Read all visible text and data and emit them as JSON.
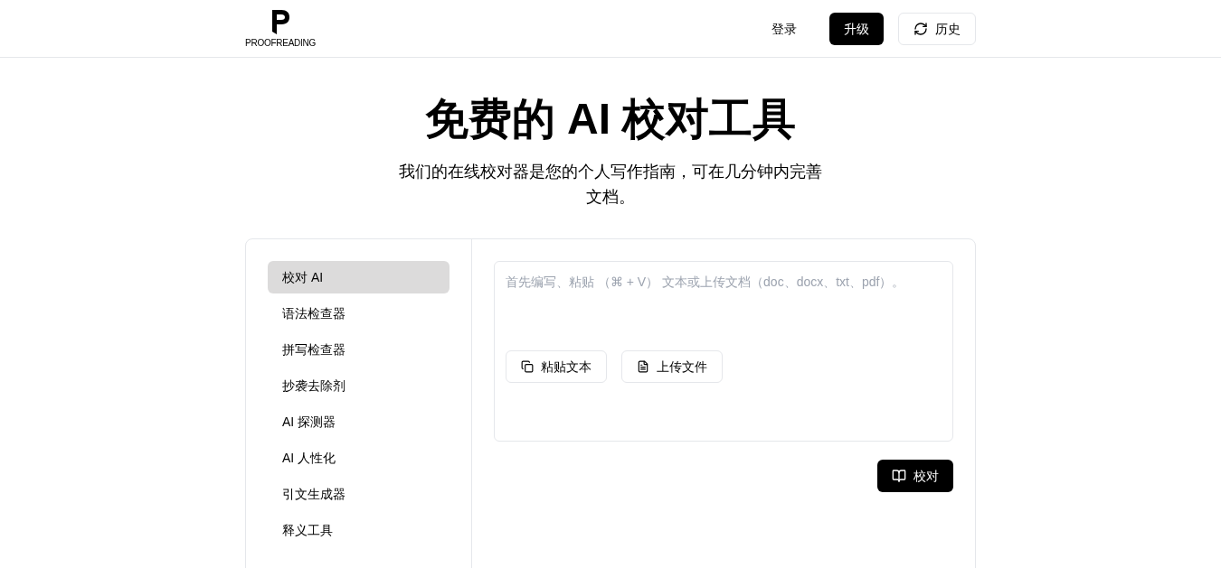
{
  "header": {
    "logo_text": "PROOFREADING",
    "login": "登录",
    "upgrade": "升级",
    "history": "历史"
  },
  "hero": {
    "title": "免费的 AI 校对工具",
    "subtitle": "我们的在线校对器是您的个人写作指南，可在几分钟内完善文档。"
  },
  "sidebar": {
    "items": [
      {
        "label": "校对 AI",
        "selected": true
      },
      {
        "label": "语法检查器",
        "selected": false
      },
      {
        "label": "拼写检查器",
        "selected": false
      },
      {
        "label": "抄袭去除剂",
        "selected": false
      },
      {
        "label": "AI 探测器",
        "selected": false
      },
      {
        "label": "AI 人性化",
        "selected": false
      },
      {
        "label": "引文生成器",
        "selected": false
      },
      {
        "label": "释义工具",
        "selected": false
      }
    ]
  },
  "editor": {
    "placeholder": "首先编写、粘贴 （⌘ + V） 文本或上传文档（doc、docx、txt、pdf）。",
    "paste_button": "粘贴文本",
    "upload_button": "上传文件",
    "submit_button": "校对"
  }
}
